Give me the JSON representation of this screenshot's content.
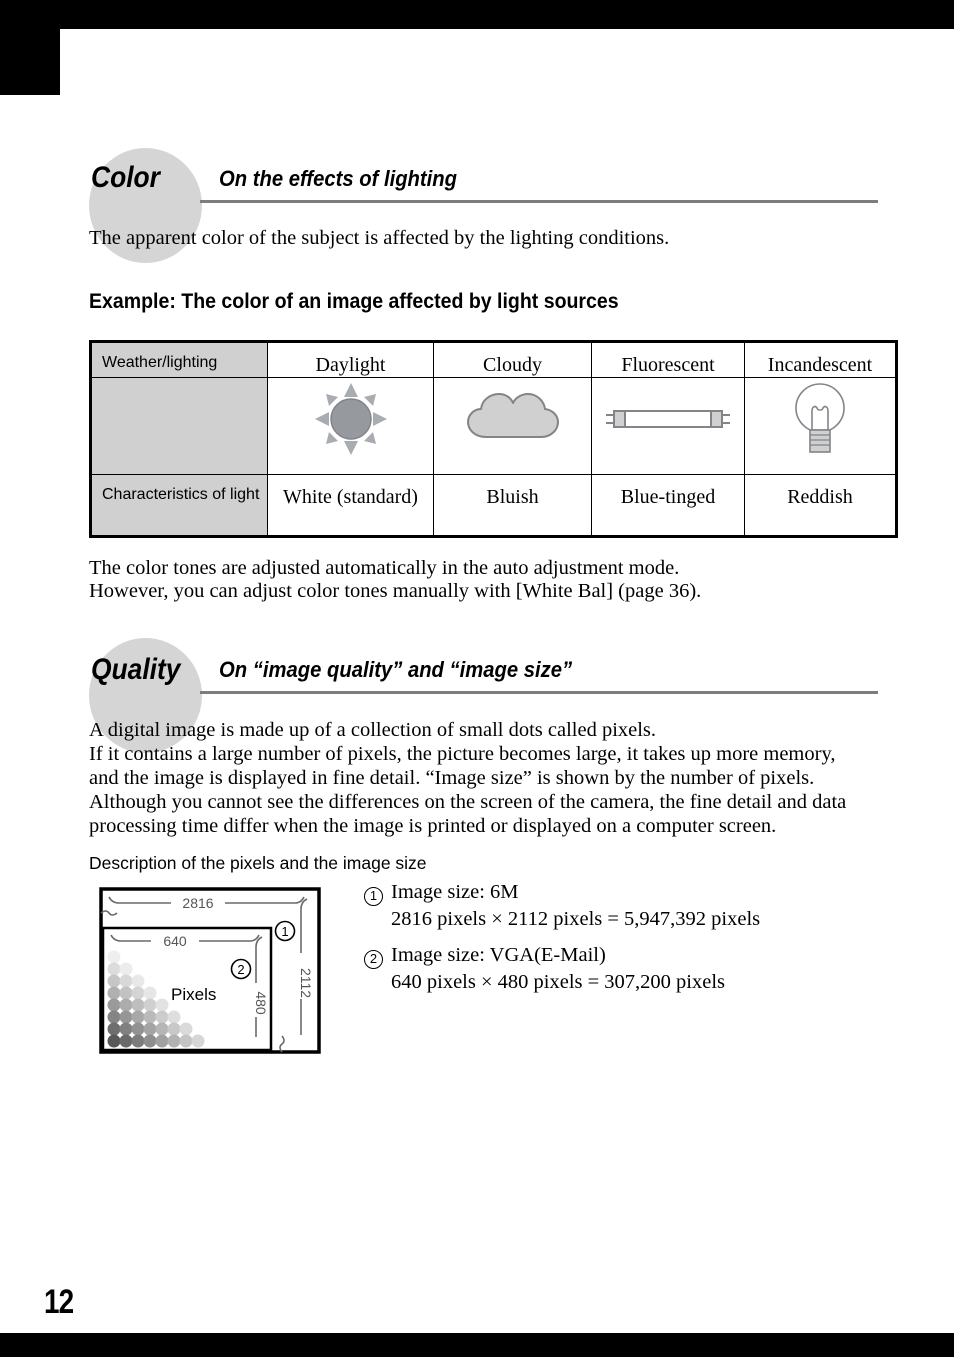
{
  "page": {
    "number": "12"
  },
  "sections": [
    {
      "tag": "Color",
      "title": "On the effects of lighting",
      "intro": "The apparent color of the subject is affected by the lighting conditions.",
      "example_heading": "Example: The color of an image affected by light sources",
      "footnote_line1": "The color tones are adjusted automatically in the auto adjustment mode.",
      "footnote_line2": "However, you can adjust color tones manually with [White Bal] (page 36)."
    },
    {
      "tag": "Quality",
      "title": "On “image quality” and “image size”",
      "paragraph_lines": [
        "A digital image is made up of a collection of small dots called pixels.",
        "If it contains a large number of pixels, the picture becomes large, it takes up more memory,",
        "and the image is displayed in fine detail. “Image size” is shown by the number of pixels.",
        "Although you cannot see the differences on the screen of the camera, the fine detail and data",
        "processing time differ when the image is printed or displayed on a computer screen."
      ],
      "diagram_heading": "Description of the pixels and the image size"
    }
  ],
  "lighting_table": {
    "row_headers": [
      "Weather/lighting",
      "Characteristics of light"
    ],
    "columns": [
      "Daylight",
      "Cloudy",
      "Fluorescent",
      "Incandescent"
    ],
    "icons": [
      "sun-icon",
      "cloud-icon",
      "fluorescent-tube-icon",
      "light-bulb-icon"
    ],
    "characteristics": [
      "White (standard)",
      "Bluish",
      "Blue-tinged",
      "Reddish"
    ]
  },
  "pixel_diagram": {
    "outer_width_label": "2816",
    "outer_height_label": "2112",
    "inner_width_label": "640",
    "inner_height_label": "480",
    "pixels_label": "Pixels",
    "callout_outer": "1",
    "callout_inner": "2"
  },
  "image_size_legend": [
    {
      "marker": "1",
      "line1": "Image size: 6M",
      "line2": "2816 pixels × 2112 pixels = 5,947,392 pixels"
    },
    {
      "marker": "2",
      "line1": "Image size: VGA(E-Mail)",
      "line2": "640 pixels × 480 pixels = 307,200 pixels"
    }
  ],
  "colors": {
    "ellipse_gray": "#d5d5d5",
    "rule_gray": "#7d7d7d",
    "table_header_gray": "#d0d0d0",
    "icon_gray": "#969a9e",
    "icon_fill_light": "#d0d0d0"
  }
}
